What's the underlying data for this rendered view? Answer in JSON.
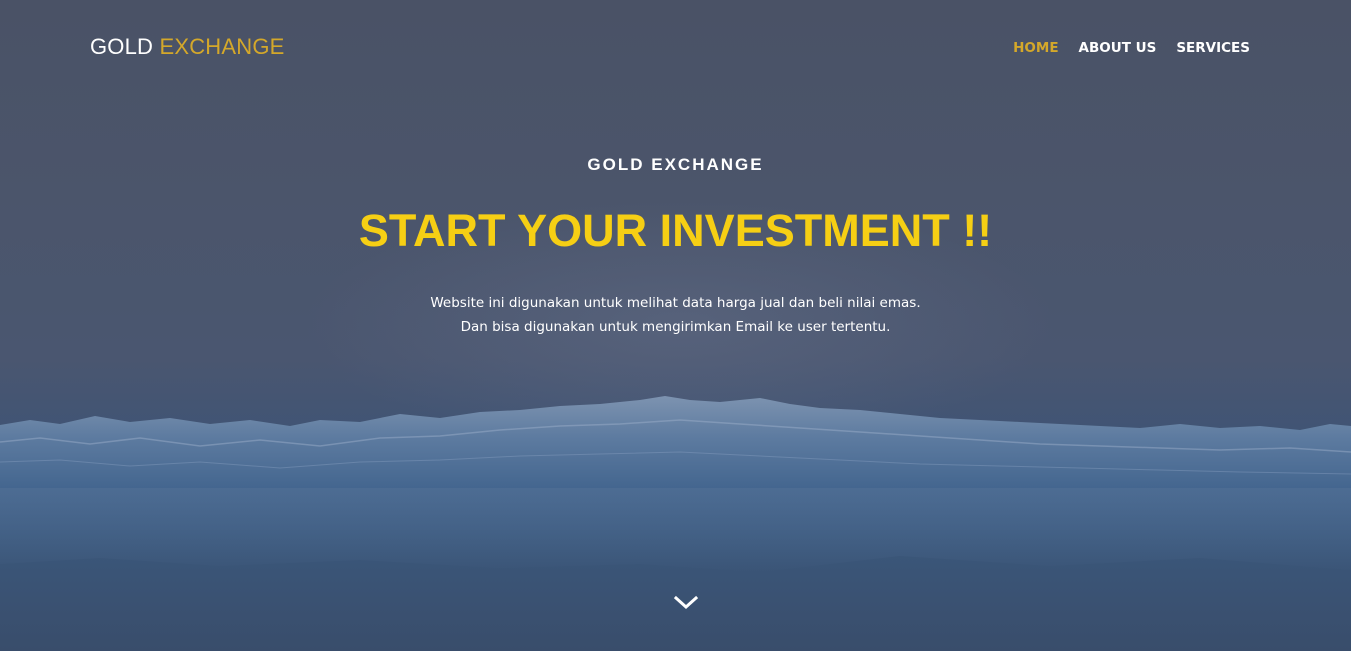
{
  "brand": {
    "part1": "GOLD",
    "part2": "EXCHANGE"
  },
  "nav": {
    "items": [
      {
        "label": "HOME",
        "active": true
      },
      {
        "label": "ABOUT US",
        "active": false
      },
      {
        "label": "SERVICES",
        "active": false
      }
    ]
  },
  "hero": {
    "eyebrow": "GOLD EXCHANGE",
    "headline": "START YOUR INVESTMENT !!",
    "description_line1": "Website ini digunakan untuk melihat data harga jual dan beli nilai emas.",
    "description_line2": "Dan bisa digunakan untuk mengirimkan Email ke user tertentu.",
    "scroll_icon": "chevron-down-icon"
  },
  "colors": {
    "accent": "#d4a82a",
    "headline": "#f6cf14",
    "background": "#4a5266"
  }
}
